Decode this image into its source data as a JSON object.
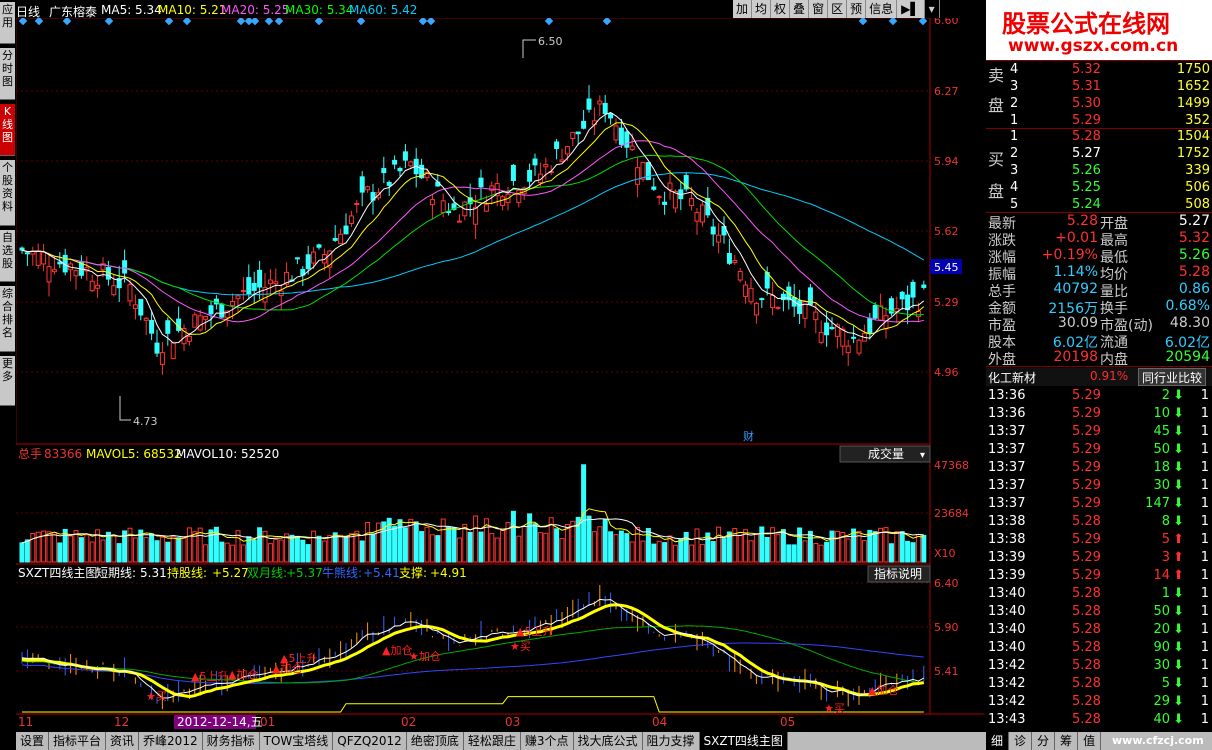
{
  "left_tabs": [
    {
      "label": "应用",
      "active": false
    },
    {
      "label": "分时图",
      "active": false
    },
    {
      "label": "K线图",
      "active": true
    },
    {
      "label": "个股资料",
      "active": false
    },
    {
      "label": "自选股",
      "active": false
    },
    {
      "label": "综合排名",
      "active": false
    },
    {
      "label": "更多",
      "active": false
    }
  ],
  "header": {
    "period": "日线",
    "stock_name": "广东榕泰",
    "ma5_label": "MA5: 5.34",
    "ma10_label": "MA10: 5.21",
    "ma20_label": "MA20: 5.25",
    "ma30_label": "MA30: 5.34",
    "ma60_label": "MA60: 5.42",
    "colors": {
      "ma5": "#ffffff",
      "ma10": "#ffff00",
      "ma20": "#ff55ff",
      "ma30": "#00ff00",
      "ma60": "#00ccff"
    }
  },
  "toolbar": [
    "加",
    "均",
    "权",
    "叠",
    "窗",
    "区",
    "预",
    "信息"
  ],
  "logo": {
    "title": "股票公式在线网",
    "url": "www.gszx.com.cn"
  },
  "main_chart": {
    "y_ticks": [
      "6.60",
      "6.27",
      "5.94",
      "5.62",
      "5.29",
      "4.96"
    ],
    "current_price": "5.45",
    "high_label": "6.50",
    "low_label": "4.73",
    "finance_mark": "财"
  },
  "volume_panel": {
    "total_label": "总手",
    "total_value": "83366",
    "mavol5": "MAVOL5: 68532",
    "mavol10": "MAVOL10: 52520",
    "selector": "成交量",
    "y_ticks": [
      "47368",
      "23684"
    ],
    "unit": "X10"
  },
  "indicator_panel": {
    "name": "SXZT四线主图",
    "short_label": "短期线:",
    "short_value": "5.31",
    "hold_label": "持股线:",
    "hold_value": "+5.27",
    "month_label": "双月线:",
    "month_value": "+5.37",
    "bull_label": "牛熊线:",
    "bull_value": "+5.41",
    "support_label": "支撑:",
    "support_value": "+4.91",
    "help": "指标说明",
    "y_ticks": [
      "6.40",
      "5.90",
      "5.41"
    ],
    "signals": [
      {
        "text": "★买",
        "color": "#ff2020"
      },
      {
        "text": "▲5上升",
        "color": "#ff2020"
      },
      {
        "text": "▲加仓",
        "color": "#ff2020"
      },
      {
        "text": "▲加仓",
        "color": "#ff2020"
      },
      {
        "text": "▲5上升",
        "color": "#ff2020"
      },
      {
        "text": "▲加仓",
        "color": "#ff2020"
      },
      {
        "text": "★加仓",
        "color": "#ff2020"
      },
      {
        "text": "▲5上升",
        "color": "#ff2020"
      },
      {
        "text": "★买",
        "color": "#ff2020"
      },
      {
        "text": "★买",
        "color": "#ff2020"
      },
      {
        "text": "▲加仓",
        "color": "#ff2020"
      }
    ]
  },
  "x_axis": {
    "labels": [
      "11",
      "12",
      "01",
      "02",
      "03",
      "04",
      "05"
    ],
    "cursor_date": "2012-12-14,五"
  },
  "order_book": {
    "sell_label_top": "卖",
    "sell_label_bottom": "盘",
    "buy_label_top": "买",
    "buy_label_bottom": "盘",
    "sell": [
      {
        "level": "4",
        "price": "5.32",
        "volume": "1750"
      },
      {
        "level": "3",
        "price": "5.31",
        "volume": "1652"
      },
      {
        "level": "2",
        "price": "5.30",
        "volume": "1499"
      },
      {
        "level": "1",
        "price": "5.29",
        "volume": "352"
      }
    ],
    "buy": [
      {
        "level": "1",
        "price": "5.28",
        "volume": "1504"
      },
      {
        "level": "2",
        "price": "5.27",
        "volume": "1752"
      },
      {
        "level": "3",
        "price": "5.26",
        "volume": "339"
      },
      {
        "level": "4",
        "price": "5.25",
        "volume": "506"
      },
      {
        "level": "5",
        "price": "5.24",
        "volume": "508"
      }
    ]
  },
  "stats": [
    {
      "l1": "最新",
      "v1": "5.28",
      "l2": "开盘",
      "v2": "5.27",
      "c1": "#ff3030",
      "c2": "#ffffff"
    },
    {
      "l1": "涨跌",
      "v1": "+0.01",
      "l2": "最高",
      "v2": "5.32",
      "c1": "#ff3030",
      "c2": "#ff3030"
    },
    {
      "l1": "涨幅",
      "v1": "+0.19%",
      "l2": "最低",
      "v2": "5.26",
      "c1": "#ff3030",
      "c2": "#33ff33"
    },
    {
      "l1": "振幅",
      "v1": "1.14%",
      "l2": "均价",
      "v2": "5.28",
      "c1": "#33ccff",
      "c2": "#ff3030"
    },
    {
      "l1": "总手",
      "v1": "40792",
      "l2": "量比",
      "v2": "0.86",
      "c1": "#33ccff",
      "c2": "#33ccff"
    },
    {
      "l1": "金额",
      "v1": "2156万",
      "l2": "换手",
      "v2": "0.68%",
      "c1": "#33ccff",
      "c2": "#33ccff"
    },
    {
      "l1": "市盈",
      "v1": "30.09",
      "l2": "市盈(动)",
      "v2": "48.30",
      "c1": "#cccccc",
      "c2": "#cccccc"
    },
    {
      "l1": "股本",
      "v1": "6.02亿",
      "l2": "流通",
      "v2": "6.02亿",
      "c1": "#33ccff",
      "c2": "#33ccff"
    },
    {
      "l1": "外盘",
      "v1": "20198",
      "l2": "内盘",
      "v2": "20594",
      "c1": "#ff3030",
      "c2": "#33ff33"
    }
  ],
  "sector": {
    "name": "化工新材",
    "change": "0.91%",
    "compare": "同行业比较"
  },
  "ticks": [
    {
      "time": "13:36",
      "price": "5.29",
      "vol": "2",
      "dir": "down",
      "n": "1"
    },
    {
      "time": "13:36",
      "price": "5.29",
      "vol": "10",
      "dir": "down",
      "n": "1"
    },
    {
      "time": "13:37",
      "price": "5.29",
      "vol": "45",
      "dir": "down",
      "n": "1"
    },
    {
      "time": "13:37",
      "price": "5.29",
      "vol": "50",
      "dir": "down",
      "n": "1"
    },
    {
      "time": "13:37",
      "price": "5.29",
      "vol": "18",
      "dir": "down",
      "n": "1"
    },
    {
      "time": "13:37",
      "price": "5.29",
      "vol": "30",
      "dir": "down",
      "n": "1"
    },
    {
      "time": "13:37",
      "price": "5.29",
      "vol": "147",
      "dir": "down",
      "n": "1"
    },
    {
      "time": "13:38",
      "price": "5.28",
      "vol": "8",
      "dir": "down",
      "n": "1"
    },
    {
      "time": "13:38",
      "price": "5.29",
      "vol": "5",
      "dir": "up",
      "n": "1"
    },
    {
      "time": "13:39",
      "price": "5.29",
      "vol": "3",
      "dir": "up",
      "n": "1"
    },
    {
      "time": "13:39",
      "price": "5.29",
      "vol": "14",
      "dir": "up",
      "n": "1"
    },
    {
      "time": "13:40",
      "price": "5.28",
      "vol": "1",
      "dir": "down",
      "n": "1"
    },
    {
      "time": "13:40",
      "price": "5.28",
      "vol": "50",
      "dir": "down",
      "n": "1"
    },
    {
      "time": "13:40",
      "price": "5.28",
      "vol": "20",
      "dir": "down",
      "n": "1"
    },
    {
      "time": "13:40",
      "price": "5.28",
      "vol": "90",
      "dir": "down",
      "n": "1"
    },
    {
      "time": "13:42",
      "price": "5.28",
      "vol": "30",
      "dir": "down",
      "n": "1"
    },
    {
      "time": "13:42",
      "price": "5.28",
      "vol": "5",
      "dir": "down",
      "n": "1"
    },
    {
      "time": "13:42",
      "price": "5.28",
      "vol": "29",
      "dir": "down",
      "n": "1"
    },
    {
      "time": "13:43",
      "price": "5.28",
      "vol": "40",
      "dir": "down",
      "n": "1"
    }
  ],
  "bottom_tabs": [
    {
      "label": "设置",
      "active": false
    },
    {
      "label": "指标平台",
      "active": false
    },
    {
      "label": "资讯",
      "active": false
    },
    {
      "label": "乔峰2012",
      "active": false
    },
    {
      "label": "财务指标",
      "active": false
    },
    {
      "label": "TOW宝塔线",
      "active": false
    },
    {
      "label": "QFZQ2012",
      "active": false
    },
    {
      "label": "绝密顶底",
      "active": false
    },
    {
      "label": "轻松跟庄",
      "active": false
    },
    {
      "label": "赚3个点",
      "active": false
    },
    {
      "label": "找大底公式",
      "active": false
    },
    {
      "label": "阻力支撑",
      "active": false
    },
    {
      "label": "SXZT四线主图",
      "active": true
    }
  ],
  "right_tabs": [
    {
      "label": "细",
      "active": true
    },
    {
      "label": "诊",
      "active": false
    },
    {
      "label": "分",
      "active": false
    },
    {
      "label": "筹",
      "active": false
    },
    {
      "label": "值",
      "active": false
    }
  ],
  "watermark": "www.cfzcj.com"
}
